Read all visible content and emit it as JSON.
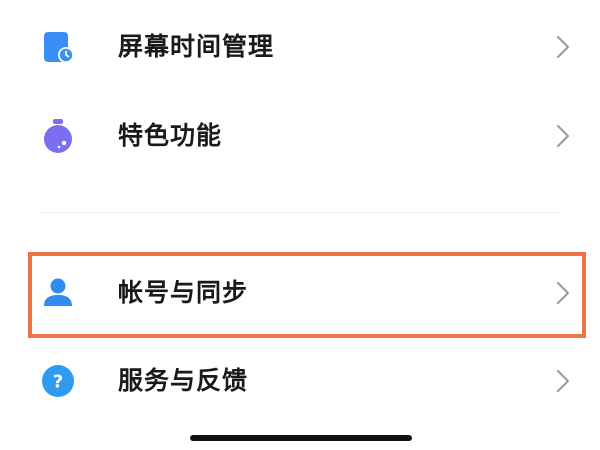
{
  "settings": {
    "items": [
      {
        "label": "屏幕时间管理",
        "icon": "screen-time-icon",
        "icon_color": "#3a8ff5"
      },
      {
        "label": "特色功能",
        "icon": "special-features-icon",
        "icon_color": "#7b6ff0"
      },
      {
        "label": "帐号与同步",
        "icon": "account-icon",
        "icon_color": "#2f8cf0",
        "highlighted": true
      },
      {
        "label": "服务与反馈",
        "icon": "help-icon",
        "icon_color": "#2f9bf0"
      }
    ],
    "chevron": "chevron-right-icon"
  },
  "colors": {
    "highlight_border": "#f0724a",
    "chevron": "#9a9a9a",
    "text": "#1a1a1a"
  }
}
